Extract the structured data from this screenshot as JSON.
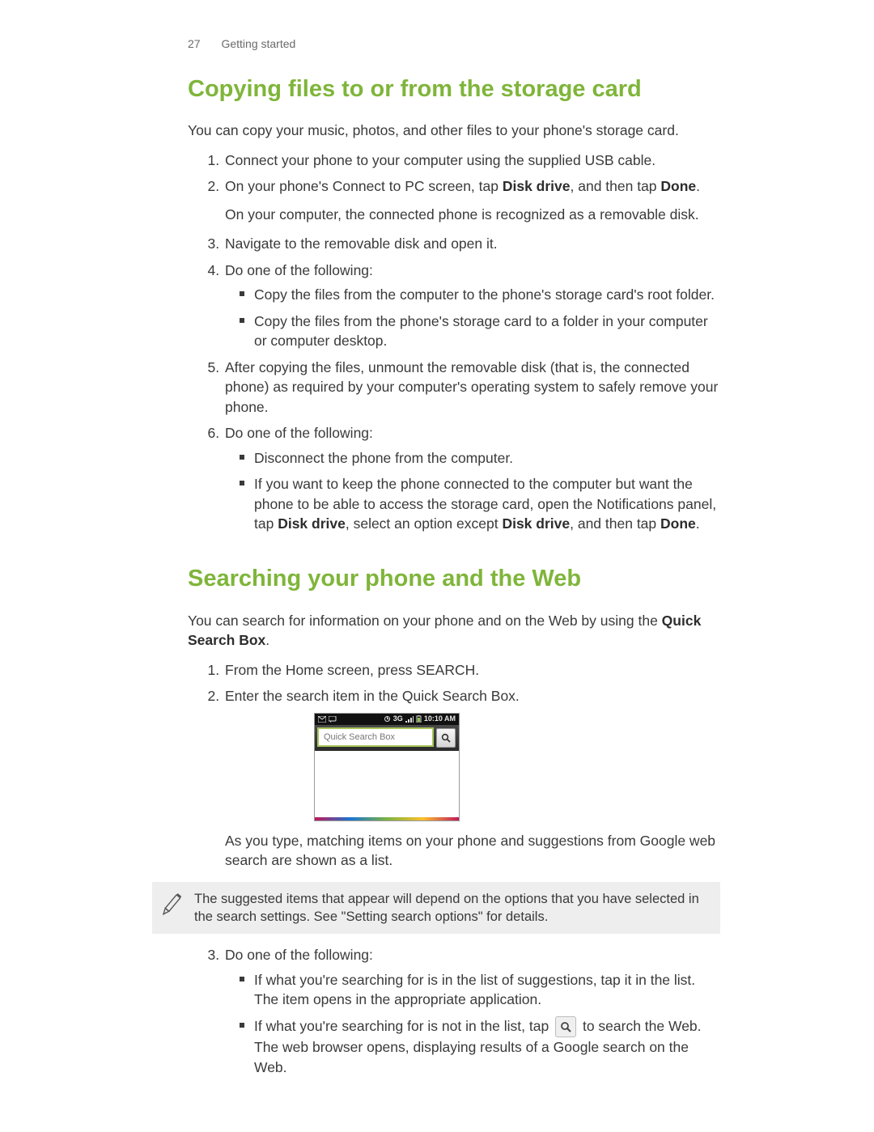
{
  "header": {
    "page_number": "27",
    "section": "Getting started"
  },
  "s1": {
    "title": "Copying files to or from the storage card",
    "intro": "You can copy your music, photos, and other files to your phone's storage card.",
    "li1": "Connect your phone to your computer using the supplied USB cable.",
    "li2_a": "On your phone's Connect to PC screen, tap ",
    "li2_b1": "Disk drive",
    "li2_c": ", and then tap ",
    "li2_b2": "Done",
    "li2_d": ".",
    "li2_sub": "On your computer, the connected phone is recognized as a removable disk.",
    "li3": "Navigate to the removable disk and open it.",
    "li4": "Do one of the following:",
    "li4_a": "Copy the files from the computer to the phone's storage card's root folder.",
    "li4_b": "Copy the files from the phone's storage card to a folder in your computer or computer desktop.",
    "li5": "After copying the files, unmount the removable disk (that is, the connected phone) as required by your computer's operating system to safely remove your phone.",
    "li6": "Do one of the following:",
    "li6_a": "Disconnect the phone from the computer.",
    "li6_b_1": "If you want to keep the phone connected to the computer but want the phone to be able to access the storage card, open the Notifications panel, tap ",
    "li6_b_b1": "Disk drive",
    "li6_b_2": ", select an option except ",
    "li6_b_b2": "Disk drive",
    "li6_b_3": ", and then tap ",
    "li6_b_b3": "Done",
    "li6_b_4": "."
  },
  "s2": {
    "title": "Searching your phone and the Web",
    "intro_a": "You can search for information on your phone and on the Web by using the ",
    "intro_b": "Quick Search Box",
    "intro_c": ".",
    "li1": "From the Home screen, press SEARCH.",
    "li2": "Enter the search item in the Quick Search Box.",
    "li2_after": "As you type, matching items on your phone and suggestions from Google web search are shown as a list.",
    "note": "The suggested items that appear will depend on the options that you have selected in the search settings. See \"Setting search options\" for details.",
    "li3": "Do one of the following:",
    "li3_a": "If what you're searching for is in the list of suggestions, tap it in the list. The item opens in the appropriate application.",
    "li3_b_1": "If what you're searching for is not in the list, tap ",
    "li3_b_2": " to search the Web. The web browser opens, displaying results of a Google search on the Web."
  },
  "phone": {
    "placeholder": "Quick Search Box",
    "net": "3G",
    "time": "10:10 AM"
  }
}
